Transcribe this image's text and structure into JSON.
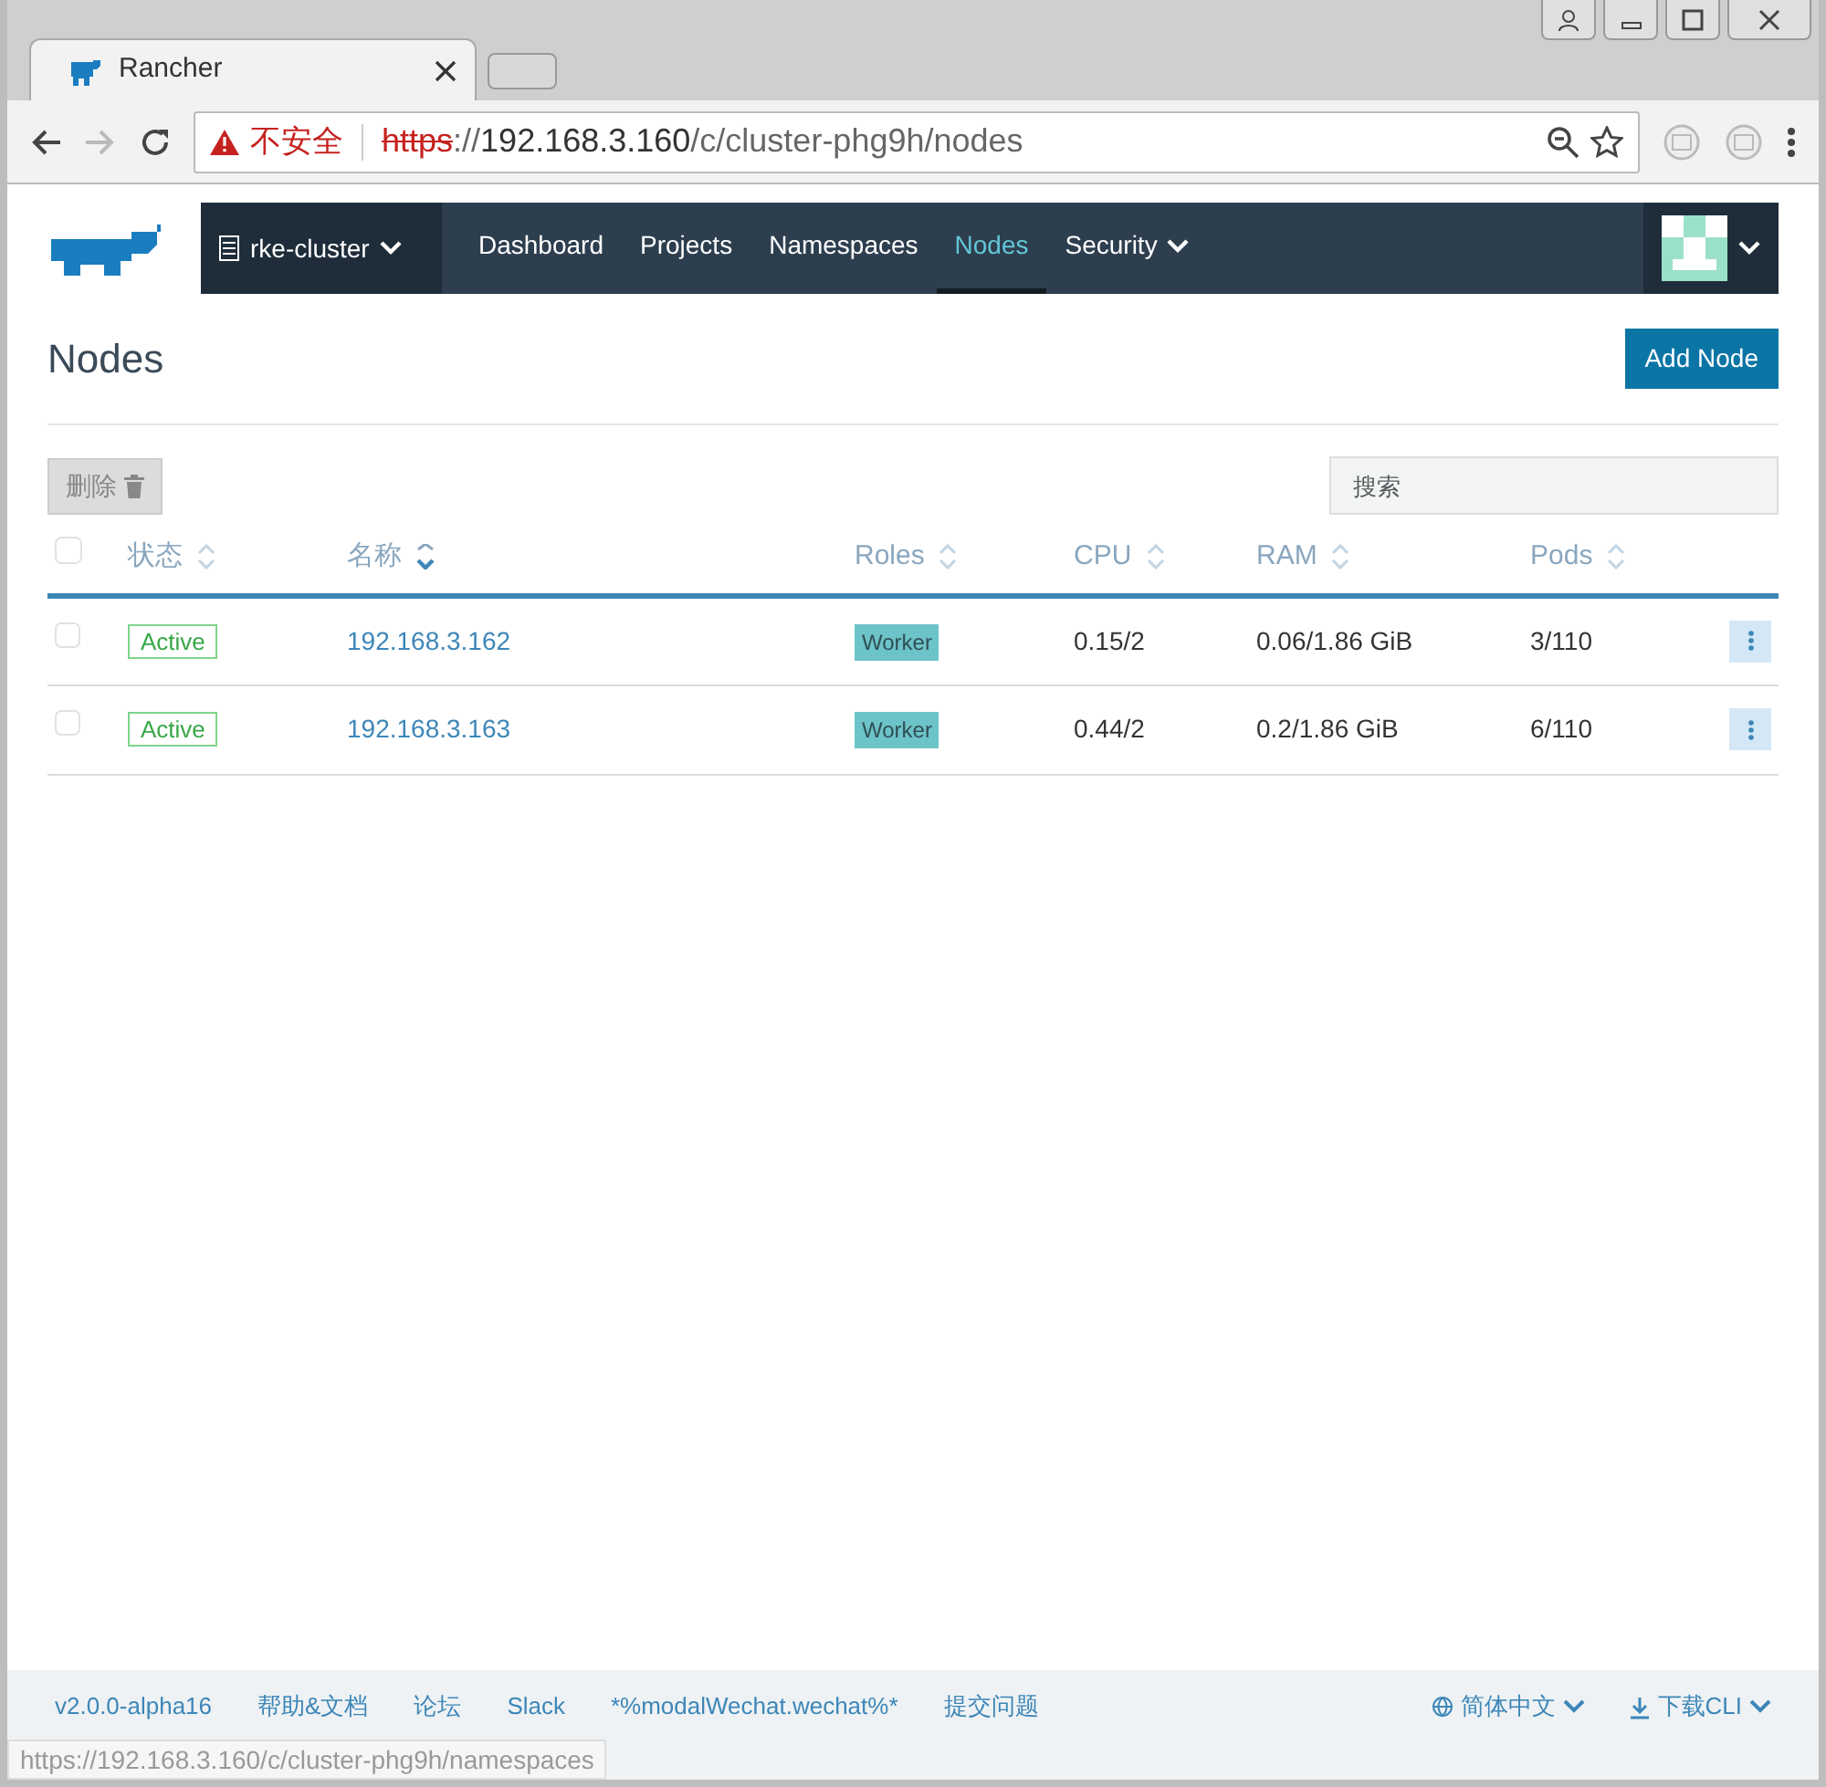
{
  "browser": {
    "tab_title": "Rancher",
    "address": {
      "warning": "不安全",
      "scheme": "https",
      "separator": "://",
      "host": "192.168.3.160",
      "path": "/c/cluster-phg9h/nodes"
    }
  },
  "header": {
    "cluster": "rke-cluster",
    "nav": [
      {
        "label": "Dashboard",
        "selected": false,
        "dropdown": false
      },
      {
        "label": "Projects",
        "selected": false,
        "dropdown": false
      },
      {
        "label": "Namespaces",
        "selected": false,
        "dropdown": false
      },
      {
        "label": "Nodes",
        "selected": true,
        "dropdown": false
      },
      {
        "label": "Security",
        "selected": false,
        "dropdown": true
      }
    ]
  },
  "page": {
    "title": "Nodes",
    "add_button": "Add Node",
    "delete_button": "删除",
    "search": {
      "placeholder": "搜索"
    }
  },
  "table": {
    "select_all_checked": false,
    "columns": [
      {
        "label": "状态",
        "sorted": false
      },
      {
        "label": "名称",
        "sorted": true
      },
      {
        "label": "Roles",
        "sorted": false
      },
      {
        "label": "CPU",
        "sorted": false
      },
      {
        "label": "RAM",
        "sorted": false
      },
      {
        "label": "Pods",
        "sorted": false
      }
    ],
    "rows": [
      {
        "checked": false,
        "state": "Active",
        "name": "192.168.3.162",
        "role": "Worker",
        "cpu": "0.15/2",
        "ram": "0.06/1.86 GiB",
        "pods": "3/110"
      },
      {
        "checked": false,
        "state": "Active",
        "name": "192.168.3.163",
        "role": "Worker",
        "cpu": "0.44/2",
        "ram": "0.2/1.86 GiB",
        "pods": "6/110"
      }
    ]
  },
  "footer": {
    "links": [
      "v2.0.0-alpha16",
      "帮助&文档",
      "论坛",
      "Slack",
      "*%modalWechat.wechat%*",
      "提交问题"
    ],
    "language": "简体中文",
    "cli": "下载CLI"
  },
  "status_url": "https://192.168.3.160/c/cluster-phg9h/namespaces"
}
